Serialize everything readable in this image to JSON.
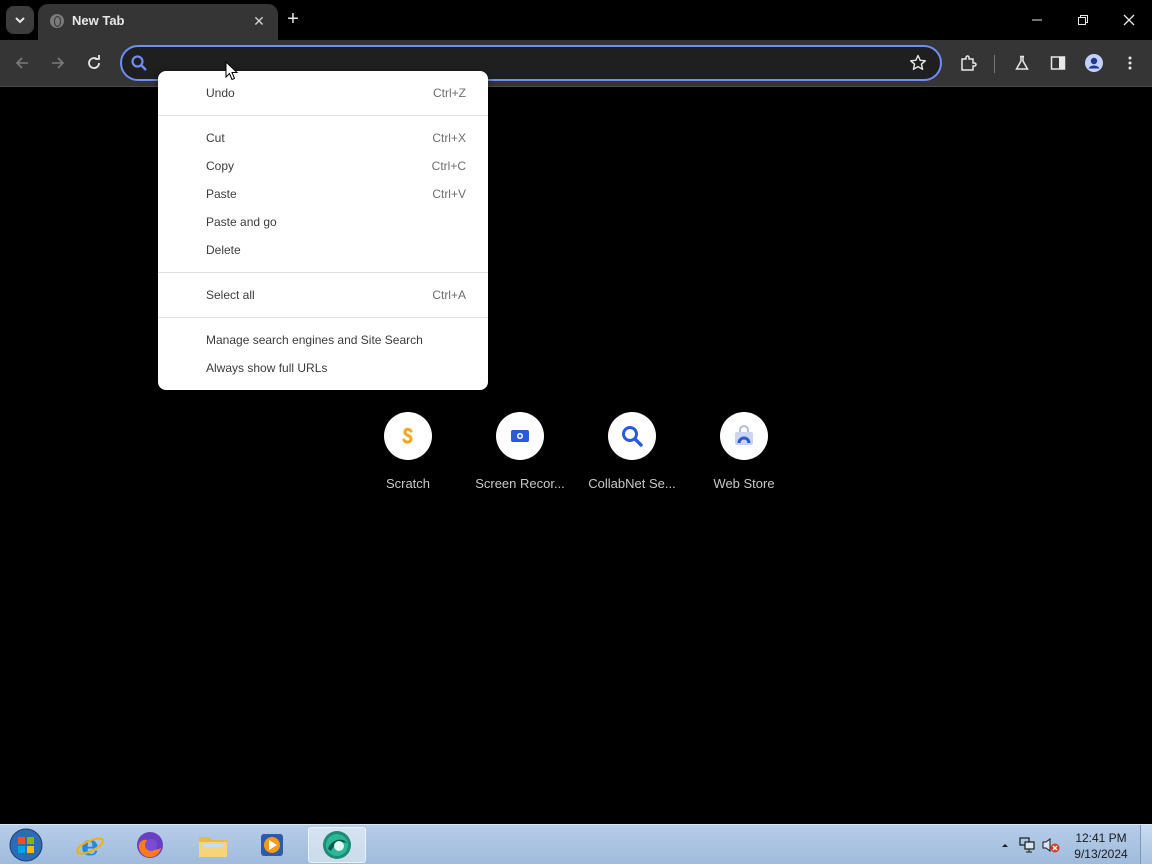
{
  "browser": {
    "tab": {
      "title": "New Tab"
    },
    "omnibox": {
      "value": "",
      "placeholder": ""
    }
  },
  "context_menu": {
    "groups": [
      [
        {
          "label": "Undo",
          "shortcut": "Ctrl+Z"
        }
      ],
      [
        {
          "label": "Cut",
          "shortcut": "Ctrl+X"
        },
        {
          "label": "Copy",
          "shortcut": "Ctrl+C"
        },
        {
          "label": "Paste",
          "shortcut": "Ctrl+V"
        },
        {
          "label": "Paste and go",
          "shortcut": ""
        },
        {
          "label": "Delete",
          "shortcut": ""
        }
      ],
      [
        {
          "label": "Select all",
          "shortcut": "Ctrl+A"
        }
      ],
      [
        {
          "label": "Manage search engines and Site Search",
          "shortcut": ""
        },
        {
          "label": "Always show full URLs",
          "shortcut": ""
        }
      ]
    ]
  },
  "shortcuts": [
    {
      "label": "Scratch",
      "icon": "scratch-icon"
    },
    {
      "label": "Screen Recor...",
      "icon": "screen-recorder-icon"
    },
    {
      "label": "CollabNet Se...",
      "icon": "search-icon"
    },
    {
      "label": "Web Store",
      "icon": "web-store-icon"
    }
  ],
  "taskbar": {
    "clock_time": "12:41 PM",
    "clock_date": "9/13/2024",
    "apps": [
      "internet-explorer-icon",
      "firefox-icon",
      "file-explorer-icon",
      "media-player-icon",
      "chrome-app-icon"
    ]
  },
  "colors": {
    "accent": "#6e8df5",
    "toolbar": "#353535",
    "background": "#000000"
  }
}
